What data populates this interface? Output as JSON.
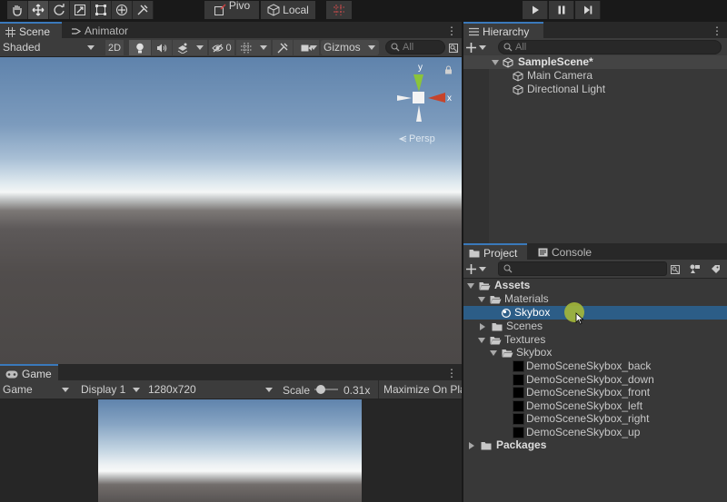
{
  "toolbar": {
    "tools": [
      "hand-icon",
      "move-icon",
      "rotate-icon",
      "scale-icon",
      "rect-icon",
      "transform-icon",
      "custom-tool-icon"
    ],
    "pivot_label": "Pivo",
    "local_label": "Local",
    "snap_icon": "grid-snap-icon",
    "play_icons": [
      "play-icon",
      "pause-icon",
      "step-icon"
    ]
  },
  "scene_panel": {
    "tabs": [
      {
        "label": "Scene",
        "icon": "grid-icon"
      },
      {
        "label": "Animator",
        "icon": "animator-icon"
      }
    ],
    "shading_mode": "Shaded",
    "mode_2d": "2D",
    "fx_count": "0",
    "gizmos_label": "Gizmos",
    "search_placeholder": "All",
    "gizmo_axes": {
      "y": "y",
      "x": "x"
    },
    "persp_label": "Persp"
  },
  "game_panel": {
    "tab_label": "Game",
    "view_type": "Game",
    "display": "Display 1",
    "resolution": "1280x720",
    "scale_label": "Scale",
    "scale_value": "0.31x",
    "scale_fraction": 0.1,
    "maximize_label": "Maximize On Pla"
  },
  "hierarchy": {
    "tab_label": "Hierarchy",
    "search_placeholder": "All",
    "scene_name": "SampleScene*",
    "objects": [
      "Main Camera",
      "Directional Light"
    ]
  },
  "project": {
    "tabs": [
      {
        "label": "Project",
        "icon": "folder-icon"
      },
      {
        "label": "Console",
        "icon": "console-icon"
      }
    ],
    "tree": {
      "assets": "Assets",
      "materials": "Materials",
      "skybox_material": "Skybox",
      "scenes": "Scenes",
      "textures": "Textures",
      "skybox_folder": "Skybox",
      "textures_list": [
        "DemoSceneSkybox_back",
        "DemoSceneSkybox_down",
        "DemoSceneSkybox_front",
        "DemoSceneSkybox_left",
        "DemoSceneSkybox_right",
        "DemoSceneSkybox_up"
      ],
      "packages": "Packages"
    }
  },
  "colors": {
    "selection": "#2c5d87",
    "tab_accent": "#3a79bb",
    "cursor_highlight": "#a4b83a",
    "gizmo_y": "#8bc43a",
    "gizmo_x": "#c6442b"
  }
}
